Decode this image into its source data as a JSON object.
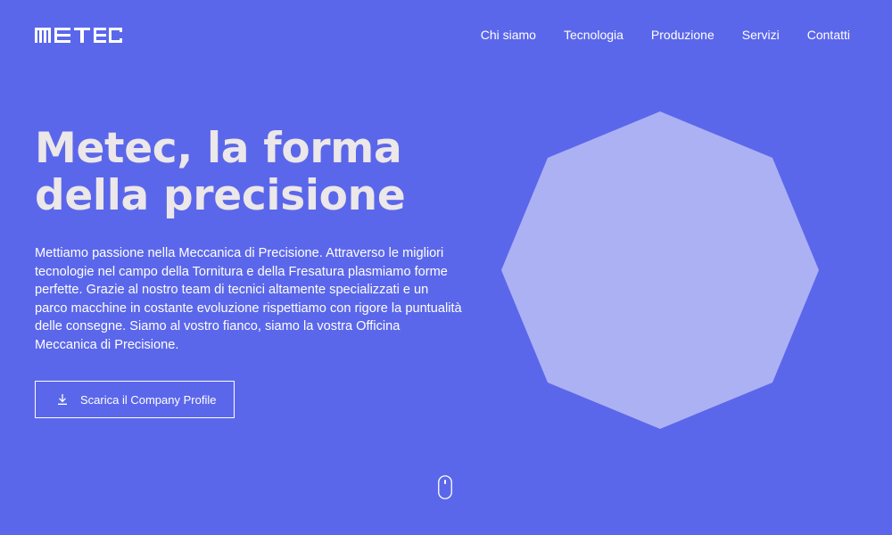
{
  "header": {
    "logo_icon": "metec-logo",
    "nav": [
      {
        "label": "Chi siamo"
      },
      {
        "label": "Tecnologia"
      },
      {
        "label": "Produzione"
      },
      {
        "label": "Servizi"
      },
      {
        "label": "Contatti"
      }
    ]
  },
  "hero": {
    "title_line1": "Metec, la forma",
    "title_line2": "della precisione",
    "description": "Mettiamo passione nella Meccanica di Precisione. Attraverso le migliori tecnologie nel campo della Tornitura e della Fresatura plasmiamo forme perfette. Grazie al nostro team di tecnici altamente specializzati e un parco macchine in costante evoluzione rispettiamo con rigore la puntualità delle consegne. Siamo al vostro fianco, siamo la vostra Officina Meccanica di Precisione.",
    "cta_label": "Scarica il Company Profile",
    "cta_icon": "download-icon"
  },
  "decor": {
    "shape_icon": "octagon-shape",
    "scroll_icon": "mouse-scroll-icon"
  },
  "colors": {
    "background": "#5b67ea",
    "octagon": "#acb1f4",
    "text": "#ece7e8"
  }
}
